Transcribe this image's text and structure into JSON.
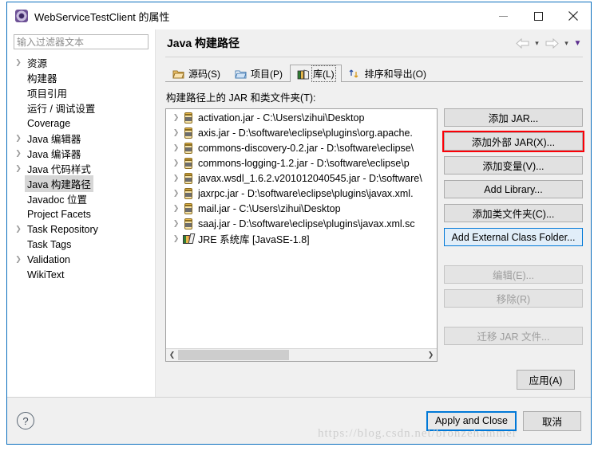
{
  "window": {
    "title": "WebServiceTestClient 的属性",
    "icon": "properties-icon",
    "minimize": "−",
    "maximize": "□",
    "close": "✕"
  },
  "sidebar": {
    "filter": {
      "value": "",
      "placeholder": "输入过滤器文本"
    },
    "items": [
      {
        "label": "资源",
        "expandable": true,
        "selected": false
      },
      {
        "label": "构建器",
        "expandable": false,
        "selected": false
      },
      {
        "label": "项目引用",
        "expandable": false,
        "selected": false
      },
      {
        "label": "运行 / 调试设置",
        "expandable": false,
        "selected": false
      },
      {
        "label": "Coverage",
        "expandable": false,
        "selected": false
      },
      {
        "label": "Java 编辑器",
        "expandable": true,
        "selected": false
      },
      {
        "label": "Java 编译器",
        "expandable": true,
        "selected": false
      },
      {
        "label": "Java 代码样式",
        "expandable": true,
        "selected": false
      },
      {
        "label": "Java 构建路径",
        "expandable": false,
        "selected": true
      },
      {
        "label": "Javadoc 位置",
        "expandable": false,
        "selected": false
      },
      {
        "label": "Project Facets",
        "expandable": false,
        "selected": false
      },
      {
        "label": "Task Repository",
        "expandable": true,
        "selected": false
      },
      {
        "label": "Task Tags",
        "expandable": false,
        "selected": false
      },
      {
        "label": "Validation",
        "expandable": true,
        "selected": false
      },
      {
        "label": "WikiText",
        "expandable": false,
        "selected": false
      }
    ]
  },
  "page": {
    "title": "Java 构建路径",
    "nav": {
      "back": "back-arrow",
      "back_caret": "▾",
      "forward": "forward-arrow",
      "forward_caret": "▾",
      "menu_caret": "▼"
    },
    "tabs": [
      {
        "label": "源码(S)",
        "icon": "source-folder-icon",
        "active": false
      },
      {
        "label": "项目(P)",
        "icon": "project-folder-icon",
        "active": false
      },
      {
        "label": "库(L)",
        "icon": "library-icon",
        "active": true
      },
      {
        "label": "排序和导出(O)",
        "icon": "order-export-icon",
        "active": false
      }
    ],
    "section_label": "构建路径上的 JAR 和类文件夹(T):",
    "entries": [
      {
        "icon": "jar-icon",
        "text": "activation.jar  -  C:\\Users\\zihui\\Desktop"
      },
      {
        "icon": "jar-icon",
        "text": "axis.jar  -  D:\\software\\eclipse\\plugins\\org.apache."
      },
      {
        "icon": "jar-icon",
        "text": "commons-discovery-0.2.jar  -  D:\\software\\eclipse\\"
      },
      {
        "icon": "jar-icon",
        "text": "commons-logging-1.2.jar  -  D:\\software\\eclipse\\p"
      },
      {
        "icon": "jar-icon",
        "text": "javax.wsdl_1.6.2.v201012040545.jar  -  D:\\software\\"
      },
      {
        "icon": "jar-icon",
        "text": "jaxrpc.jar  -  D:\\software\\eclipse\\plugins\\javax.xml."
      },
      {
        "icon": "jar-icon",
        "text": "mail.jar  -  C:\\Users\\zihui\\Desktop"
      },
      {
        "icon": "jar-icon",
        "text": "saaj.jar  -  D:\\software\\eclipse\\plugins\\javax.xml.sc"
      },
      {
        "icon": "library-icon",
        "text": "JRE 系统库 [JavaSE-1.8]"
      }
    ],
    "scrollbar": {
      "left_arrow": "❮",
      "right_arrow": "❯",
      "thumb_percent": 45
    },
    "buttons": [
      {
        "label": "添加 JAR...",
        "state": "normal"
      },
      {
        "label": "添加外部 JAR(X)...",
        "state": "annotated"
      },
      {
        "label": "添加变量(V)...",
        "state": "normal"
      },
      {
        "label": "Add Library...",
        "state": "normal"
      },
      {
        "label": "添加类文件夹(C)...",
        "state": "normal"
      },
      {
        "label": "Add External Class Folder...",
        "state": "focused"
      },
      {
        "label": "编辑(E)...",
        "state": "disabled"
      },
      {
        "label": "移除(R)",
        "state": "disabled"
      },
      {
        "label": "迁移 JAR 文件...",
        "state": "disabled"
      }
    ],
    "apply_label": "应用(A)"
  },
  "footer": {
    "help": "?",
    "apply_and_close": "Apply and Close",
    "cancel": "取消"
  },
  "watermark": "https://blog.csdn.net/bronzehammer",
  "colors": {
    "accent": "#0078d7",
    "annotation": "#fb0007",
    "window_border": "#0a6ebd",
    "dialog_bg": "#f0f0f0"
  }
}
